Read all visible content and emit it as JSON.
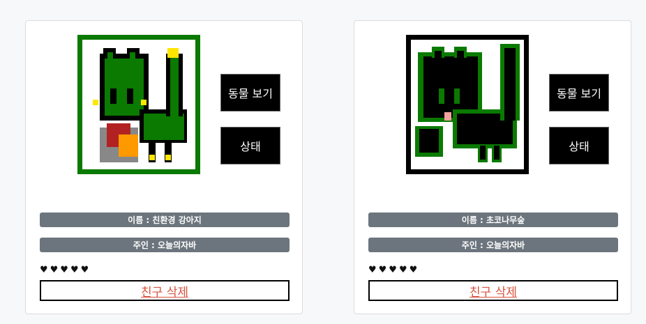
{
  "friends": [
    {
      "frame_color": "#0a7a00",
      "view_button": "동물 보기",
      "status_button": "상태",
      "name": "이름 : 친환경 강아지",
      "owner": "주인 : 오늘의자바",
      "hearts": "♥♥♥♥♥",
      "delete_button": "친구 삭제"
    },
    {
      "frame_color": "#000000",
      "view_button": "동물 보기",
      "status_button": "상태",
      "name": "이름 : 초코나무숲",
      "owner": "주인 : 오늘의자바",
      "hearts": "♥♥♥♥♥",
      "delete_button": "친구 삭제"
    }
  ]
}
